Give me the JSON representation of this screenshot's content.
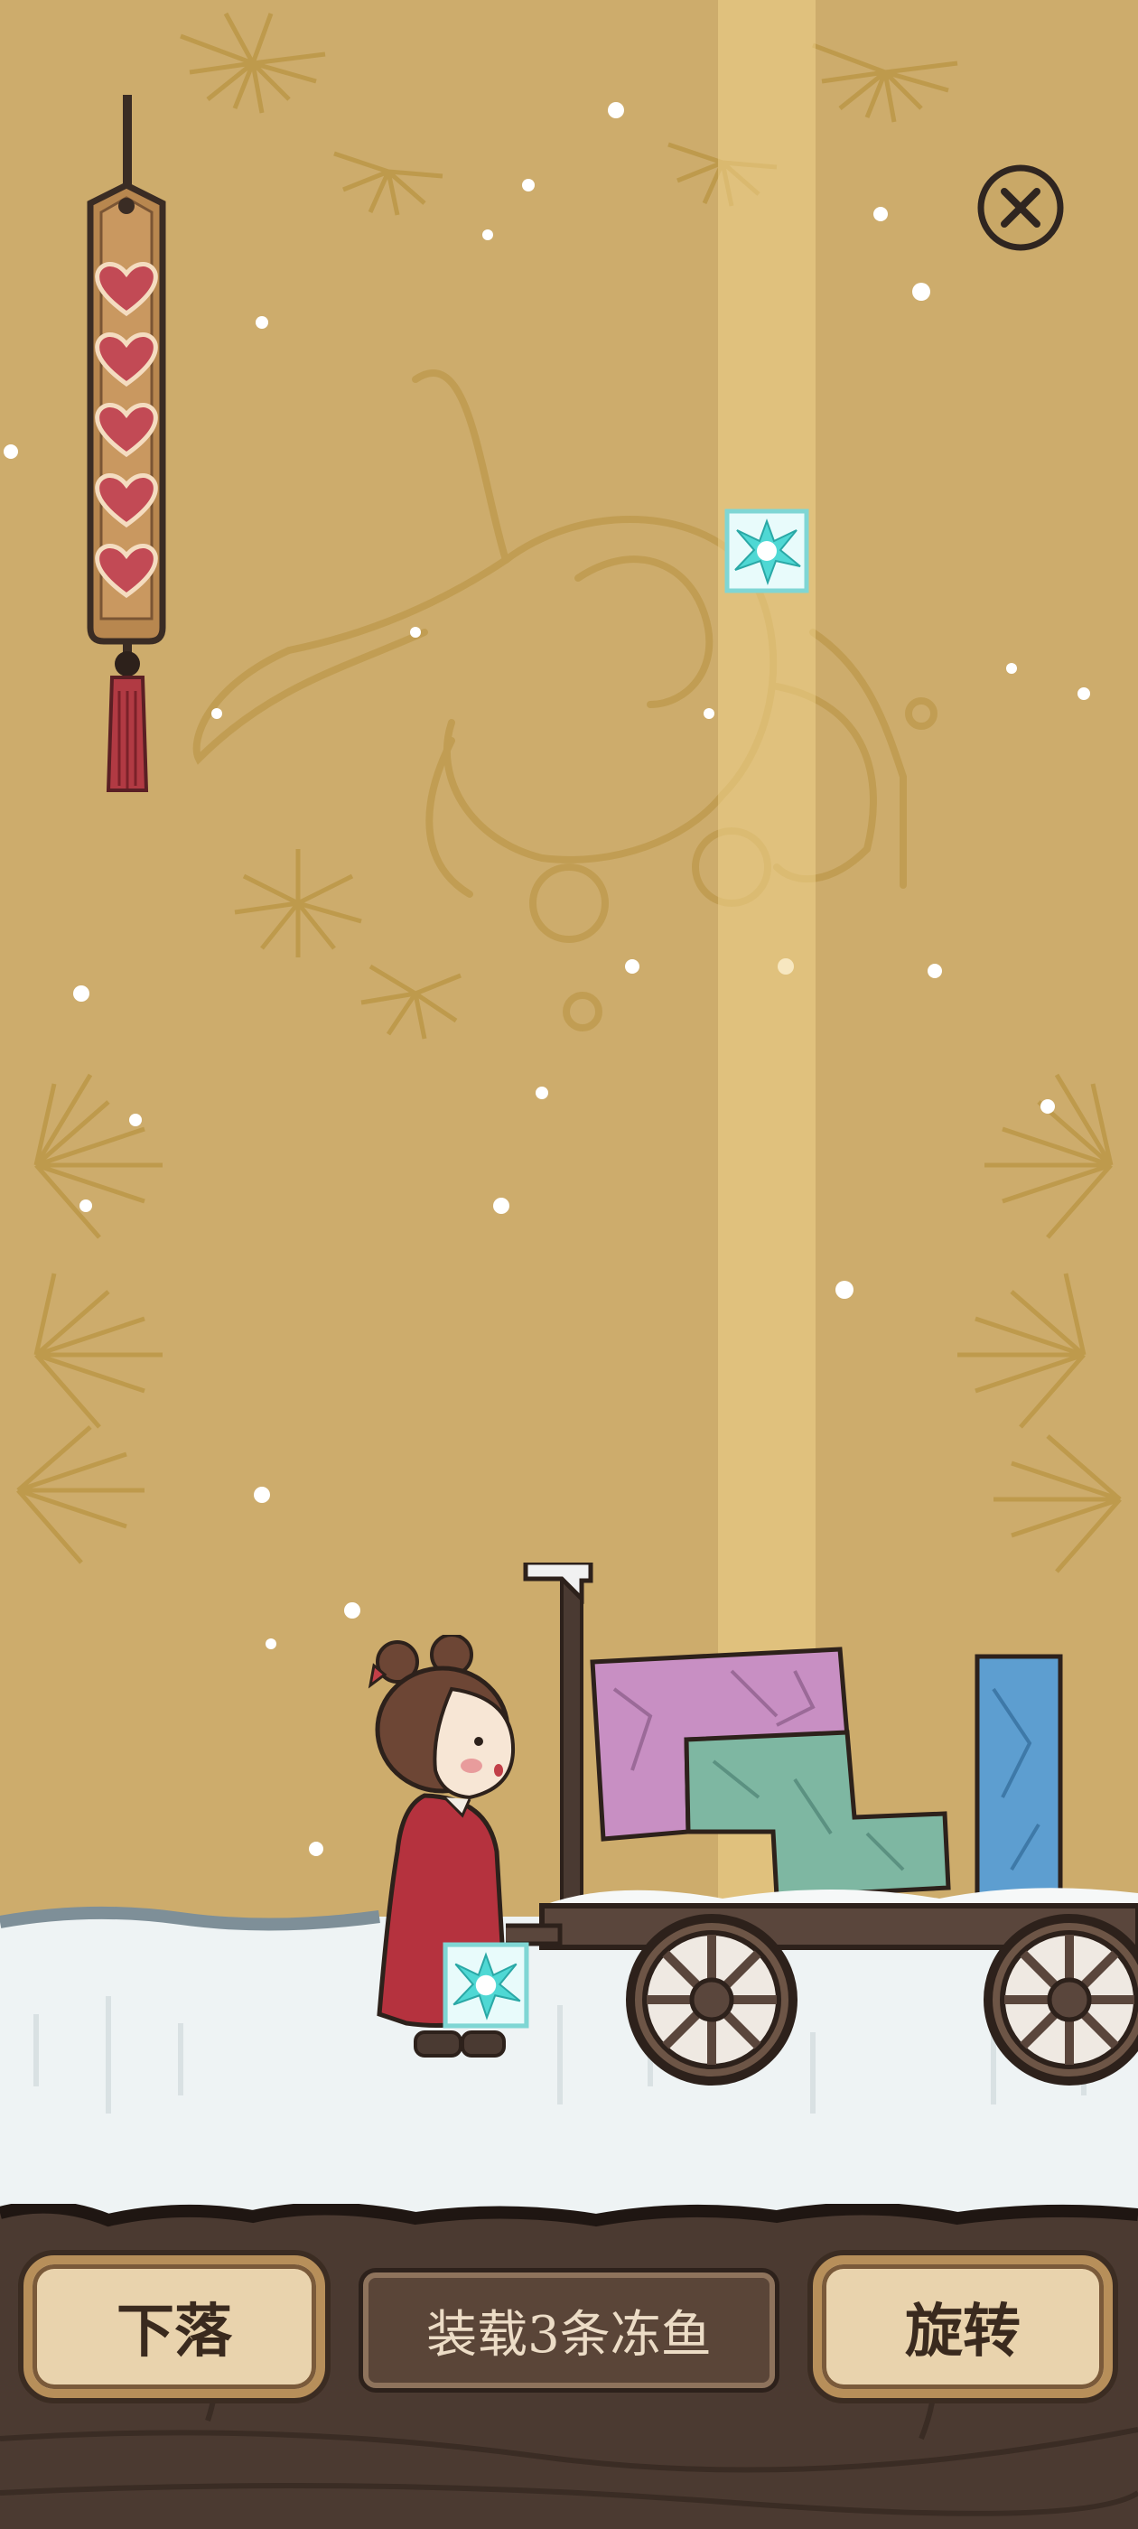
{
  "hud": {
    "lives_count": 5,
    "close_icon": "close-circle-icon"
  },
  "game": {
    "falling_piece": "ice-block-icon",
    "held_piece": "ice-block-icon",
    "cart_blocks": [
      "purple-frozen-fish",
      "green-frozen-fish",
      "blue-frozen-fish"
    ]
  },
  "controls": {
    "drop_label": "下落",
    "task_label": "装载3条冻鱼",
    "rotate_label": "旋转"
  },
  "colors": {
    "background": "#cdac6c",
    "heart": "#c24a55",
    "ice": "#5fe0dc",
    "purple_block": "#c88fc3",
    "green_block": "#7eb7a2",
    "blue_block": "#5d9ed0"
  }
}
